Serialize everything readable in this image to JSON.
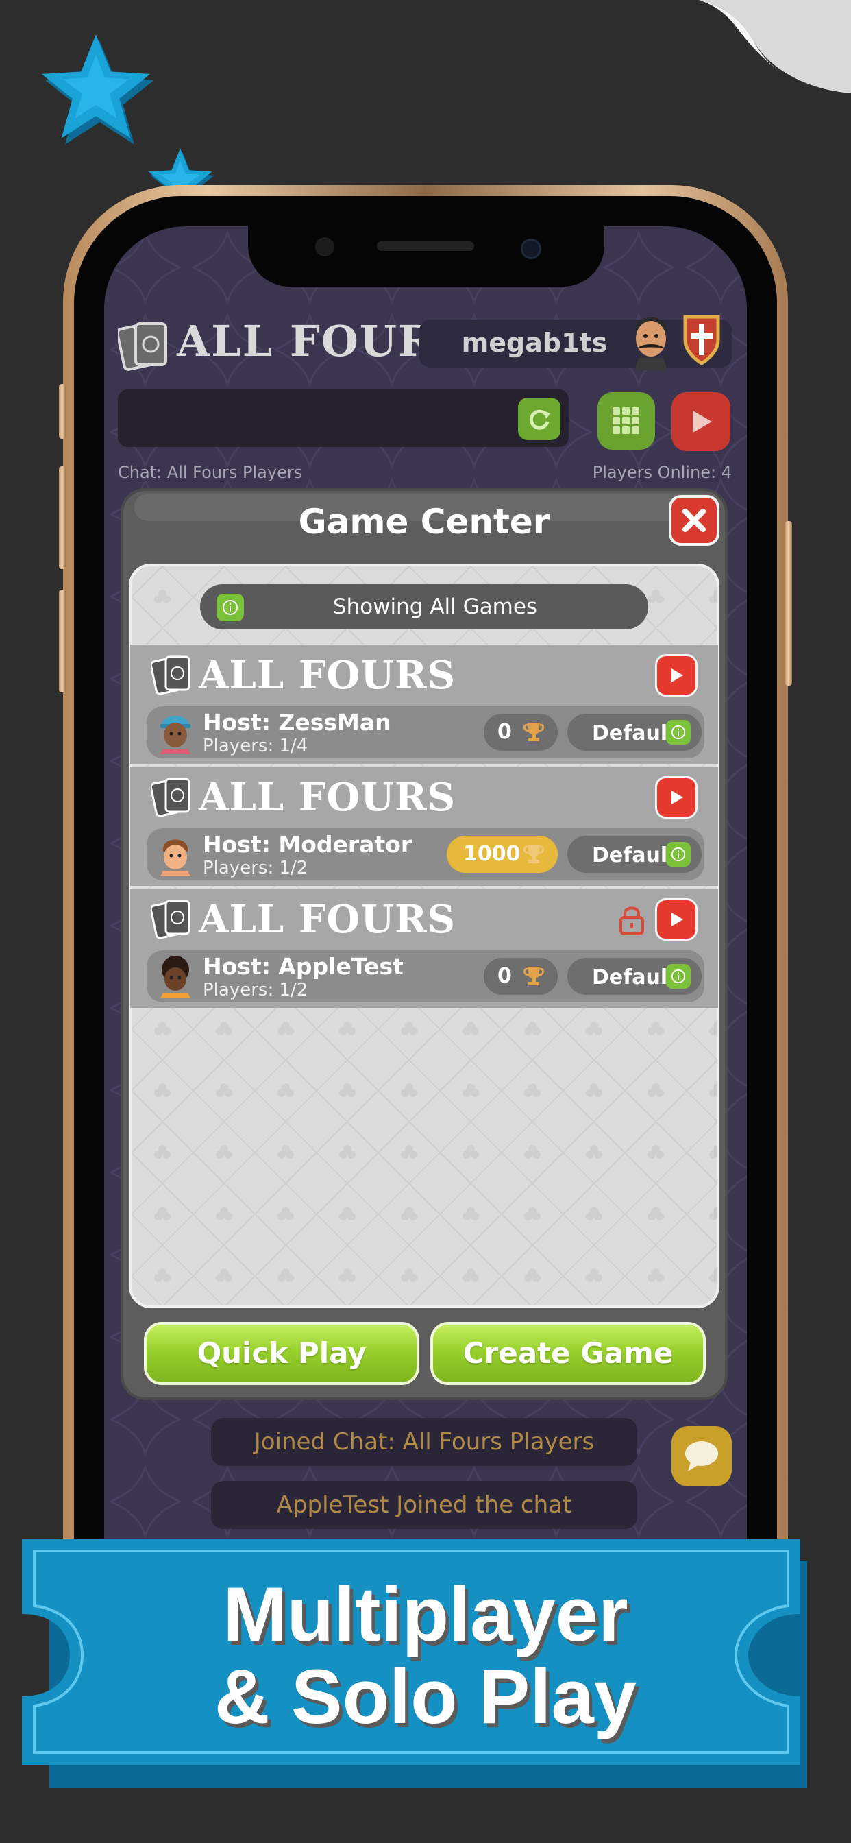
{
  "header": {
    "logo_text": "ALL FOURS",
    "username": "megab1ts",
    "chat_label": "Chat: All Fours Players",
    "players_online": "Players Online: 4"
  },
  "modal": {
    "title": "Game Center",
    "filter_text": "Showing All Games",
    "games": [
      {
        "title": "ALL FOURS",
        "host": "Host: ZessMan",
        "players": "Players: 1/4",
        "stake": "0",
        "mode": "Default",
        "locked": false
      },
      {
        "title": "ALL FOURS",
        "host": "Host: Moderator",
        "players": "Players: 1/2",
        "stake": "1000",
        "mode": "Default",
        "locked": false
      },
      {
        "title": "ALL FOURS",
        "host": "Host: AppleTest",
        "players": "Players: 1/2",
        "stake": "0",
        "mode": "Default",
        "locked": true
      }
    ],
    "quick_play_label": "Quick Play",
    "create_game_label": "Create Game"
  },
  "chat": {
    "messages": [
      "Joined Chat: All Fours Players",
      "AppleTest Joined the chat"
    ]
  },
  "banner": {
    "line1": "Multiplayer",
    "line2": "& Solo Play"
  },
  "colors": {
    "accent_green": "#98d02c",
    "accent_red": "#e63a2e",
    "banner_blue": "#0f8fc4",
    "gold": "#e6b93c"
  },
  "icons": [
    "refresh-icon",
    "grid-icon",
    "play-icon",
    "close-icon",
    "info-icon",
    "trophy-icon",
    "lock-icon",
    "chat-bubble-icon",
    "star-icon"
  ]
}
